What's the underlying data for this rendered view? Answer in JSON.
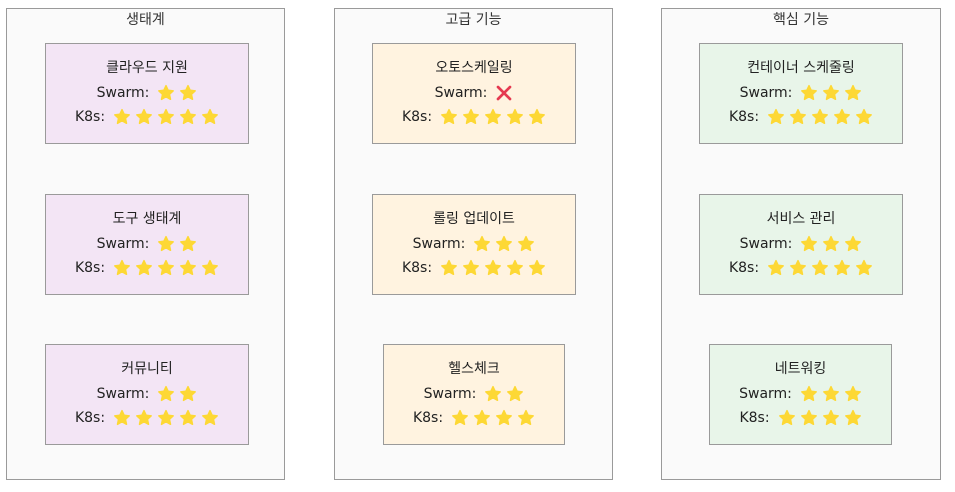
{
  "colors": {
    "ecosystem_fill": "#f3e5f5",
    "advanced_fill": "#fff3e0",
    "core_fill": "#e8f5e9",
    "star": "#fdd835",
    "cross": "#e53950"
  },
  "groups": [
    {
      "title": "생태계",
      "items": [
        {
          "title": "클라우드 지원",
          "swarm_label": "Swarm:",
          "swarm_rating": 2,
          "k8s_label": "K8s:",
          "k8s_rating": 5
        },
        {
          "title": "도구 생태계",
          "swarm_label": "Swarm:",
          "swarm_rating": 2,
          "k8s_label": "K8s:",
          "k8s_rating": 5
        },
        {
          "title": "커뮤니티",
          "swarm_label": "Swarm:",
          "swarm_rating": 2,
          "k8s_label": "K8s:",
          "k8s_rating": 5
        }
      ]
    },
    {
      "title": "고급 기능",
      "items": [
        {
          "title": "오토스케일링",
          "swarm_label": "Swarm:",
          "swarm_rating": 0,
          "swarm_icon": "cross-icon",
          "k8s_label": "K8s:",
          "k8s_rating": 5
        },
        {
          "title": "롤링 업데이트",
          "swarm_label": "Swarm:",
          "swarm_rating": 3,
          "k8s_label": "K8s:",
          "k8s_rating": 5
        },
        {
          "title": "헬스체크",
          "swarm_label": "Swarm:",
          "swarm_rating": 2,
          "k8s_label": "K8s:",
          "k8s_rating": 4
        }
      ]
    },
    {
      "title": "핵심 기능",
      "items": [
        {
          "title": "컨테이너 스케줄링",
          "swarm_label": "Swarm:",
          "swarm_rating": 3,
          "k8s_label": "K8s:",
          "k8s_rating": 5
        },
        {
          "title": "서비스 관리",
          "swarm_label": "Swarm:",
          "swarm_rating": 3,
          "k8s_label": "K8s:",
          "k8s_rating": 5
        },
        {
          "title": "네트워킹",
          "swarm_label": "Swarm:",
          "swarm_rating": 3,
          "k8s_label": "K8s:",
          "k8s_rating": 4
        }
      ]
    }
  ]
}
